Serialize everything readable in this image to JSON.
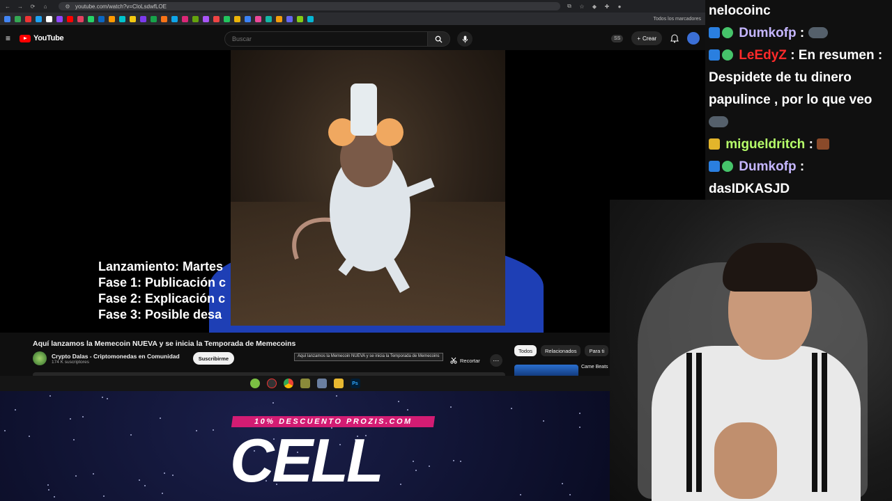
{
  "browser": {
    "url": "youtube.com/watch?v=CloLsdwfLOE",
    "bookmarks_label": "Todos los marcadores"
  },
  "youtube": {
    "logo_text": "YouTube",
    "search_placeholder": "Buscar",
    "ss_badge": "SS",
    "create_label": "Crear",
    "video": {
      "subtitle_lines": [
        "Lanzamiento: Martes",
        "Fase 1: Publicación c",
        "Fase 2: Explicación c",
        "Fase 3: Posible desa"
      ]
    },
    "title": "Aquí lanzamos la Memecoin NUEVA y se inicia la Temporada de Memecoins",
    "channel": {
      "name": "Crypto Dalas - Criptomonedas en Comunidad",
      "subscribers": "174 K suscriptores",
      "subscribe_label": "Suscribirme"
    },
    "tooltip": "Aquí lanzamos la Memecoin NUEVA y se inicia la Temporada de Memecoins",
    "clip_label": "Recortar",
    "chips": [
      "Todos",
      "Relacionados",
      "Para ti"
    ],
    "recommended_title": "Came Beats Prettyurl 0"
  },
  "promo": {
    "tag": "10% DESCUENTO PROZIS.COM",
    "code": "CELL"
  },
  "chat": {
    "messages": [
      {
        "user": "nelocoinc",
        "user_color": "#ffffff",
        "text": ""
      },
      {
        "user": "Dumkofp",
        "user_color": "#c5b6ff",
        "text": ":"
      },
      {
        "user": "LeEdyZ",
        "user_color": "#ff2a2a",
        "text": ": En resumen : Despidete de tu dinero papulince , por lo que veo"
      },
      {
        "user": "migueldritch",
        "user_color": "#b6ff6a",
        "text": ":"
      },
      {
        "user": "Dumkofp",
        "user_color": "#c5b6ff",
        "text": ": dasIDKASJD"
      }
    ]
  },
  "colors": {
    "yt_red": "#ff0000",
    "promo_pink": "#d31c73",
    "accent_blue": "#2a7fe0"
  }
}
